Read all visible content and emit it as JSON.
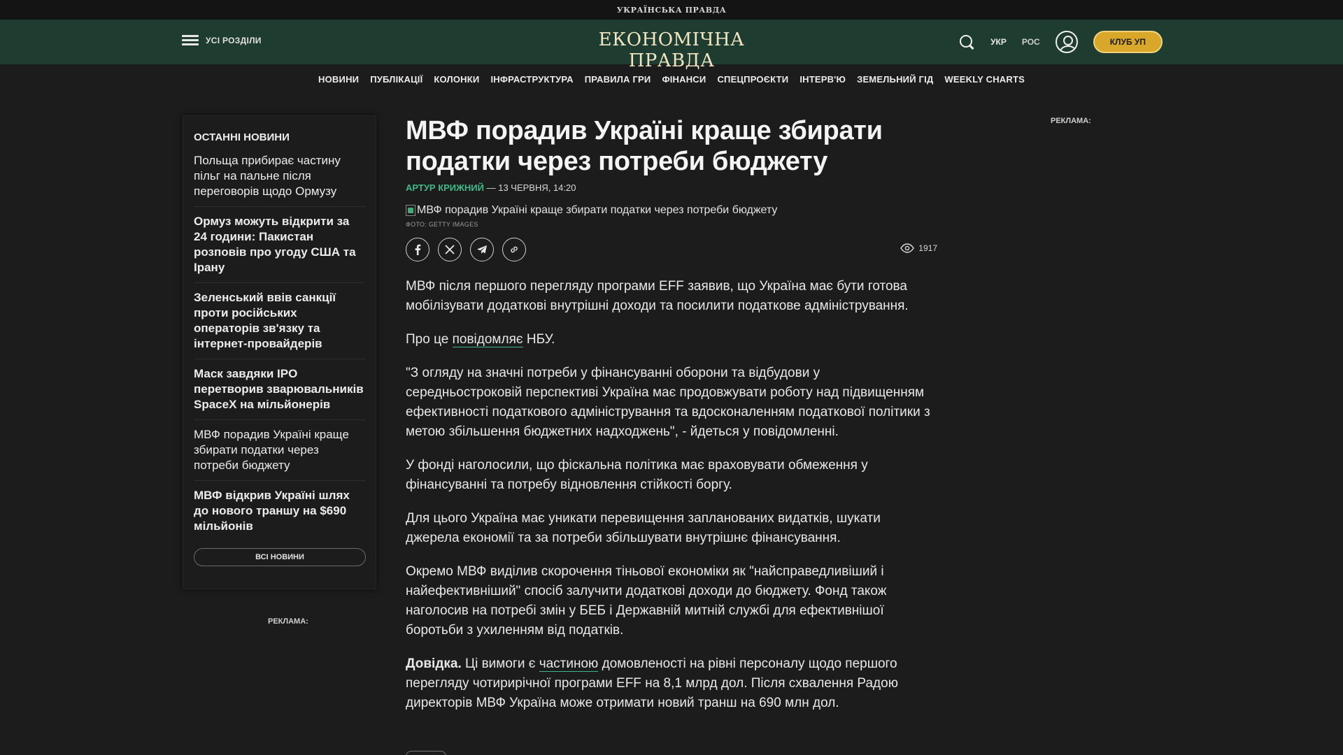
{
  "topbar": {
    "brand": "УКРАЇНСЬКА ПРАВДА"
  },
  "header": {
    "menu_label": "УСІ РОЗДІЛИ",
    "logo": "ЕКОНОМІЧНА ПРАВДА",
    "lang_ukr": "УКР",
    "lang_ros": "РОС",
    "club_label": "КЛУБ УП"
  },
  "nav": {
    "items": [
      "НОВИНИ",
      "ПУБЛІКАЦІЇ",
      "КОЛОНКИ",
      "ІНФРАСТРУКТУРА",
      "ПРАВИЛА ГРИ",
      "ФІНАНСИ",
      "СПЕЦПРОЄКТИ",
      "ІНТЕРВ'Ю",
      "ЗЕМЕЛЬНИЙ ГІД",
      "WEEKLY CHARTS"
    ]
  },
  "sidebar": {
    "title": "ОСТАННІ НОВИНИ",
    "items": [
      "Польща прибирає частину пільг на пальне після переговорів щодо Ормузу",
      "Ормуз можуть відкрити за 24 години: Пакистан розповів про угоду США та Ірану",
      "Зеленський ввів санкції проти російських операторів зв'язку та інтернет-провайдерів",
      "Маск завдяки IPO перетворив зварювальників SpaceX на мільйонерів",
      "МВФ порадив Україні краще збирати податки через потреби бюджету",
      "МВФ відкрив Україні шлях до нового траншу на $690 мільйонів"
    ],
    "all_news": "ВСІ НОВИНИ",
    "ad_label": "РЕКЛАМА:"
  },
  "article": {
    "title": "МВФ порадив Україні краще збирати податки через потреби бюджету",
    "author": "АРТУР КРИЖНИЙ",
    "date": " — 13 ЧЕРВНЯ, 14:20",
    "image_alt": "МВФ порадив Україні краще збирати податки через потреби бюджету",
    "photo_credit": "ФОТО: GETTY IMAGES",
    "views": "1917",
    "p1": "МВФ після першого перегляду програми EFF заявив, що Україна має бути готова мобілізувати додаткові внутрішні доходи та посилити податкове адміністрування.",
    "p2_pre": "Про це ",
    "p2_link": "повідомляє",
    "p2_post": " НБУ.",
    "p3": "\"З огляду на значні потреби у фінансуванні оборони та відбудови у середньостроковій перспективі Україна має продовжувати роботу над підвищенням ефективності податкового адміністрування та вдосконаленням податкової політики з метою збільшення бюджетних надходжень\", - йдеться у повідомленні.",
    "p4": "У фонді наголосили, що фіскальна політика має враховувати обмеження у фінансуванні та потребу відновлення стійкості боргу.",
    "p5": "Для цього Україна має уникати перевищення запланованих видатків, шукати джерела економії та за потреби збільшувати внутрішнє фінансування.",
    "p6": "Окремо МВФ виділив скорочення тіньової економіки як \"найсправедливіший і найефективніший\" спосіб залучити додаткові доходи до бюджету. Фонд також наголосив на потребі змін у БЕБ і Державній митній службі для ефективнішої боротьби з ухиленням від податків.",
    "p7_strong": "Довідка.",
    "p7_pre": " Ці вимоги є ",
    "p7_link": "частиною",
    "p7_post": " домовленості на рівні персоналу щодо першого перегляду чотирирічної програми EFF на 8,1 млрд дол. Після схвалення Радою директорів МВФ Україна може отримати новий транш на 690 млн дол."
  },
  "right_ad": "РЕКЛАМА:",
  "colors": {
    "header_bg": "#1f3c30",
    "accent": "#3fb98a",
    "club": "#d9a82b"
  }
}
